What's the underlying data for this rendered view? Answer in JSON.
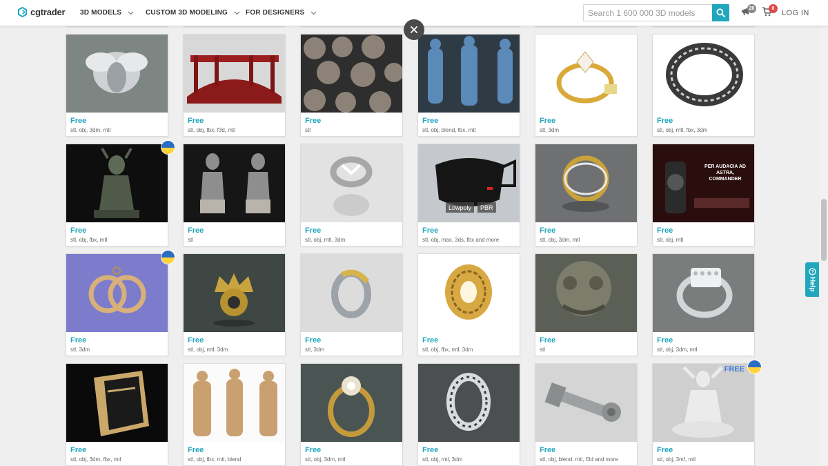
{
  "header": {
    "logo_text": "cgtrader",
    "nav": [
      {
        "label": "3D MODELS"
      },
      {
        "label": "CUSTOM 3D MODELING"
      },
      {
        "label": "FOR DESIGNERS"
      }
    ],
    "search_placeholder": "Search 1 600 000 3D models",
    "notifications_count": "20",
    "cart_count": "0",
    "login_label": "LOG IN"
  },
  "colors": {
    "accent": "#21a7bd",
    "badge_gray": "#8a8a8a",
    "badge_red": "#e04a4a"
  },
  "help_label": "Help",
  "cards": [
    {
      "price": "Free",
      "formats": "stl, obj, 3dm, mtl",
      "icon": "bee-jewel"
    },
    {
      "price": "Free",
      "formats": "stl, obj, fbx, f3d, mtl",
      "icon": "red-bridge"
    },
    {
      "price": "Free",
      "formats": "stl",
      "icon": "stone-tiles"
    },
    {
      "price": "Free",
      "formats": "stl, obj, blend, fbx, mtl",
      "icon": "soldier-figures"
    },
    {
      "price": "Free",
      "formats": "stl, 3dm",
      "icon": "gold-ring"
    },
    {
      "price": "Free",
      "formats": "stl, obj, mtl, fbx, 3dm",
      "icon": "celtic-ring"
    },
    {
      "price": "Free",
      "formats": "stl, obj, fbx, mtl",
      "icon": "demon-statue",
      "flag": true
    },
    {
      "price": "Free",
      "formats": "stl",
      "icon": "twin-statues"
    },
    {
      "price": "Free",
      "formats": "stl, obj, mtl, 3dm",
      "icon": "silver-ring"
    },
    {
      "price": "Free",
      "formats": "stl, obj, max, 3ds, fbx and more",
      "icon": "face-mask",
      "tags": [
        "Lowpoly",
        "PBR"
      ]
    },
    {
      "price": "Free",
      "formats": "stl, obj, 3dm, mtl",
      "icon": "wave-ring"
    },
    {
      "price": "Free",
      "formats": "stl, obj, mtl",
      "icon": "commander-poster",
      "img_text": "PER AUDACIA AD ASTRA, COMMANDER"
    },
    {
      "price": "Free",
      "formats": "stl, 3dm",
      "icon": "cc-pendant",
      "flag": true
    },
    {
      "price": "Free",
      "formats": "stl, obj, mtl, 3dm",
      "icon": "crown-pendant"
    },
    {
      "price": "Free",
      "formats": "stl, 3dm",
      "icon": "twist-ring"
    },
    {
      "price": "Free",
      "formats": "stl, obj, fbx, mtl, 3dm",
      "icon": "filigree-ring"
    },
    {
      "price": "Free",
      "formats": "stl",
      "icon": "lion-sculpture"
    },
    {
      "price": "Free",
      "formats": "stl, obj, 3dm, mtl",
      "icon": "diamond-ring"
    },
    {
      "price": "Free",
      "formats": "stl, obj, 3dm, fbx, mtl",
      "icon": "faceted-ring"
    },
    {
      "price": "Free",
      "formats": "stl, obj, fbx, mtl, blend",
      "icon": "soldier-miniatures"
    },
    {
      "price": "Free",
      "formats": "stl, obj, 3dm, mtl",
      "icon": "flower-ring"
    },
    {
      "price": "Free",
      "formats": "stl, obj, mtl, 3dm",
      "icon": "ornate-band"
    },
    {
      "price": "Free",
      "formats": "stl, obj, blend, mtl, f3d and more",
      "icon": "bolt"
    },
    {
      "price": "Free",
      "formats": "stl, obj, 3mf, mtl",
      "icon": "figure-statue",
      "flag": true,
      "free_tag": "FREE"
    }
  ]
}
